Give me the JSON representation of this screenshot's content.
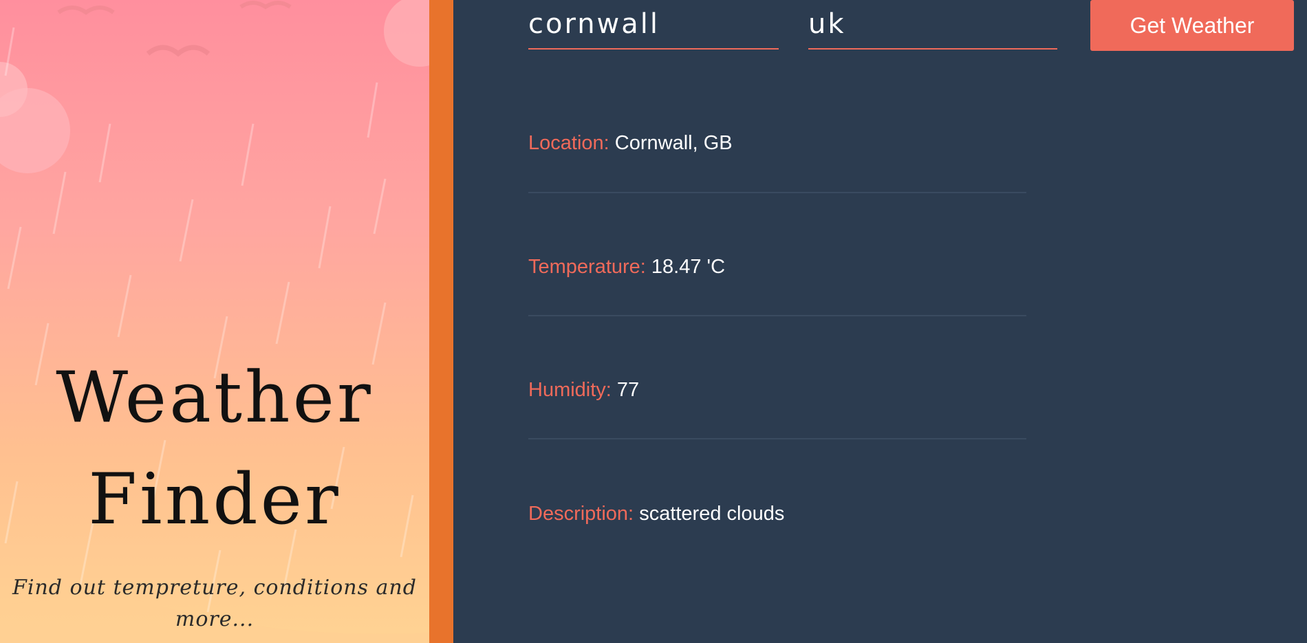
{
  "app": {
    "title": "Weather Finder",
    "title_line1": "Weather",
    "title_line2": "Finder",
    "subtitle": "Find out tempreture, conditions and more..."
  },
  "form": {
    "city_value": "cornwall",
    "country_value": "uk",
    "button_label": "Get Weather"
  },
  "results": [
    {
      "label": "Location:",
      "value": "Cornwall, GB"
    },
    {
      "label": "Temperature:",
      "value": "18.47 'C"
    },
    {
      "label": "Humidity:",
      "value": "77"
    },
    {
      "label": "Description:",
      "value": "scattered clouds"
    }
  ],
  "colors": {
    "accent": "#f06a5a",
    "bar": "#e8732c",
    "panel": "#2c3c50"
  }
}
